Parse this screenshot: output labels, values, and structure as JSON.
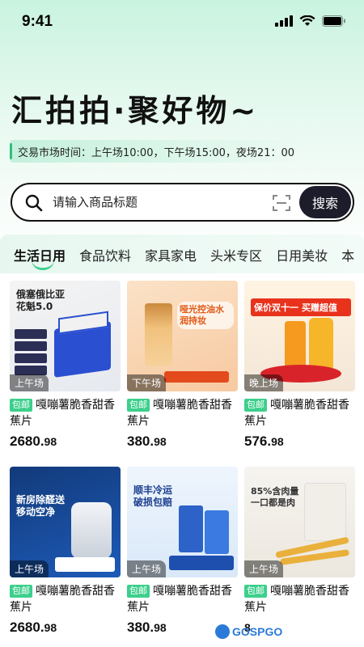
{
  "status_bar": {
    "time": "9:41",
    "icons": [
      "signal-icon",
      "wifi-icon",
      "battery-icon"
    ]
  },
  "hero": {
    "title": "汇拍拍·聚好物~"
  },
  "market_time": {
    "text": "交易市场时间：上午场10:00，下午场15:00，夜场21：00"
  },
  "search": {
    "placeholder": "请输入商品标题",
    "button_label": "搜索"
  },
  "tabs": [
    {
      "label": "生活日用",
      "active": true
    },
    {
      "label": "食品饮料",
      "active": false
    },
    {
      "label": "家具家电",
      "active": false
    },
    {
      "label": "头米专区",
      "active": false
    },
    {
      "label": "日用美妆",
      "active": false
    },
    {
      "label": "本",
      "active": false
    }
  ],
  "products": [
    {
      "session": "上午场",
      "tag": "包邮",
      "title": "嘎嘣薯脆香甜香蕉片",
      "price_int": "2680.",
      "price_dec": "98",
      "image_text": "俄塞俄比亚花魁5.0"
    },
    {
      "session": "下午场",
      "tag": "包邮",
      "title": "嘎嘣薯脆香甜香蕉片",
      "price_int": "380.",
      "price_dec": "98",
      "image_text": "哑光控油水润持妆"
    },
    {
      "session": "晚上场",
      "tag": "包邮",
      "title": "嘎嘣薯脆香甜香蕉片",
      "price_int": "576.",
      "price_dec": "98",
      "image_text": "保价双十一 买赠超值"
    },
    {
      "session": "上午场",
      "tag": "包邮",
      "title": "嘎嘣薯脆香甜香蕉片",
      "price_int": "2680.",
      "price_dec": "98",
      "image_text": "新房除醛送移动空净"
    },
    {
      "session": "上午场",
      "tag": "包邮",
      "title": "嘎嘣薯脆香甜香蕉片",
      "price_int": "380.",
      "price_dec": "98",
      "image_text": "顺丰冷运破损包赔"
    },
    {
      "session": "上午场",
      "tag": "包邮",
      "title": "嘎嘣薯脆香甜香蕉片",
      "price_int": "",
      "price_dec": "8",
      "image_text": "85%含肉量一口都是肉"
    }
  ],
  "watermark": {
    "text": "GOSPGO"
  },
  "colors": {
    "accent": "#3dcf8c",
    "dark": "#1c1c2a"
  }
}
